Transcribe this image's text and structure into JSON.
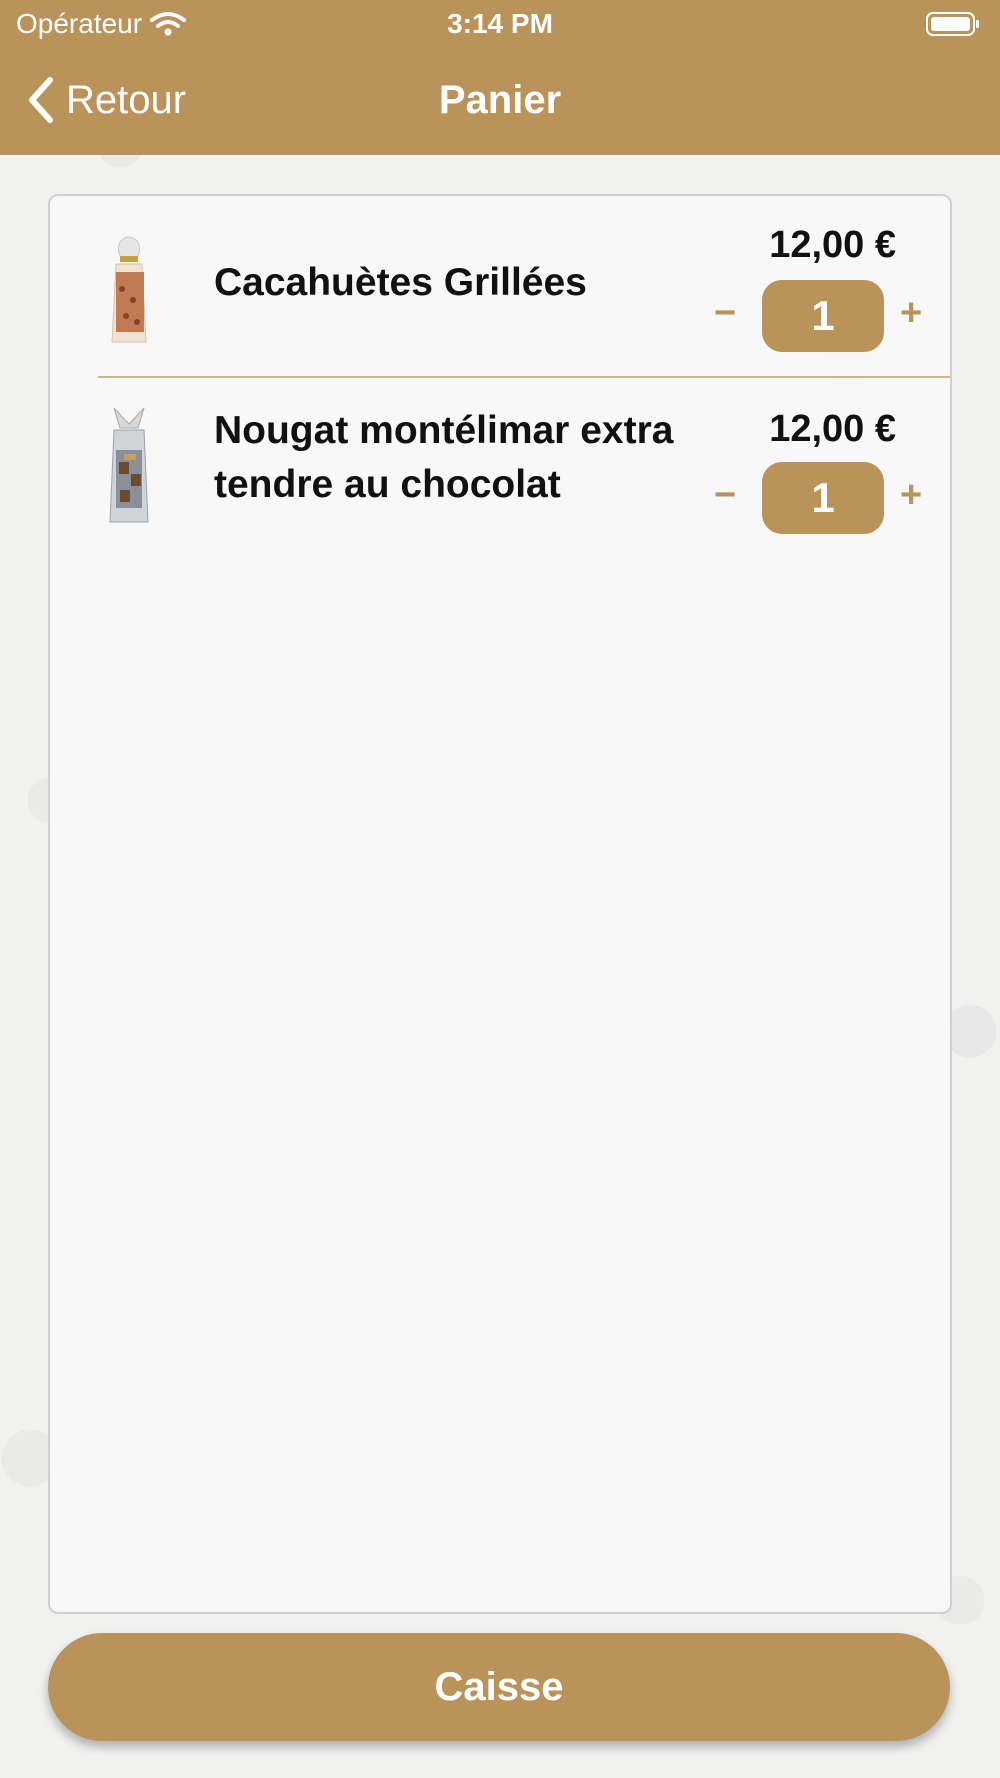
{
  "status_bar": {
    "carrier": "Opérateur",
    "time": "3:14 PM"
  },
  "nav": {
    "back_label": "Retour",
    "title": "Panier"
  },
  "cart": {
    "items": [
      {
        "name": "Cacahuètes Grillées",
        "price": "12,00 €",
        "quantity": "1",
        "minus": "−",
        "plus": "+"
      },
      {
        "name": "Nougat montélimar extra tendre au chocolat",
        "price": "12,00 €",
        "quantity": "1",
        "minus": "−",
        "plus": "+"
      }
    ]
  },
  "checkout": {
    "label": "Caisse"
  },
  "colors": {
    "accent": "#b99359",
    "card": "#f8f8f8",
    "text": "#111111"
  }
}
